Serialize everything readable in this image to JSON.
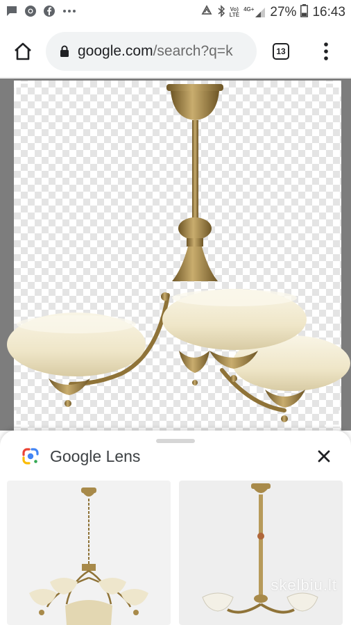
{
  "status_bar": {
    "battery_percent": "27%",
    "time": "16:43",
    "volte_top": "Vo)",
    "volte_bottom": "LTE",
    "network_type": "4G+",
    "icons": [
      "message-icon",
      "chrome-icon",
      "facebook-icon",
      "more-dots-icon",
      "data-saver-icon",
      "bluetooth-icon",
      "volte-icon",
      "signal-icon",
      "battery-icon"
    ]
  },
  "browser": {
    "url_host": "google.com",
    "url_path": "/search?q=k",
    "tab_count": "13"
  },
  "lens": {
    "brand_google": "Google",
    "brand_lens": "Lens",
    "results": [
      {
        "watermark": ""
      },
      {
        "watermark": "skelbiu.lt"
      }
    ]
  },
  "colors": {
    "lens_blue": "#4285f4",
    "lens_red": "#ea4335",
    "lens_yellow": "#fbbc05",
    "lens_green": "#34a853",
    "brass": "#a88a4a",
    "glass": "#f0ead1"
  }
}
